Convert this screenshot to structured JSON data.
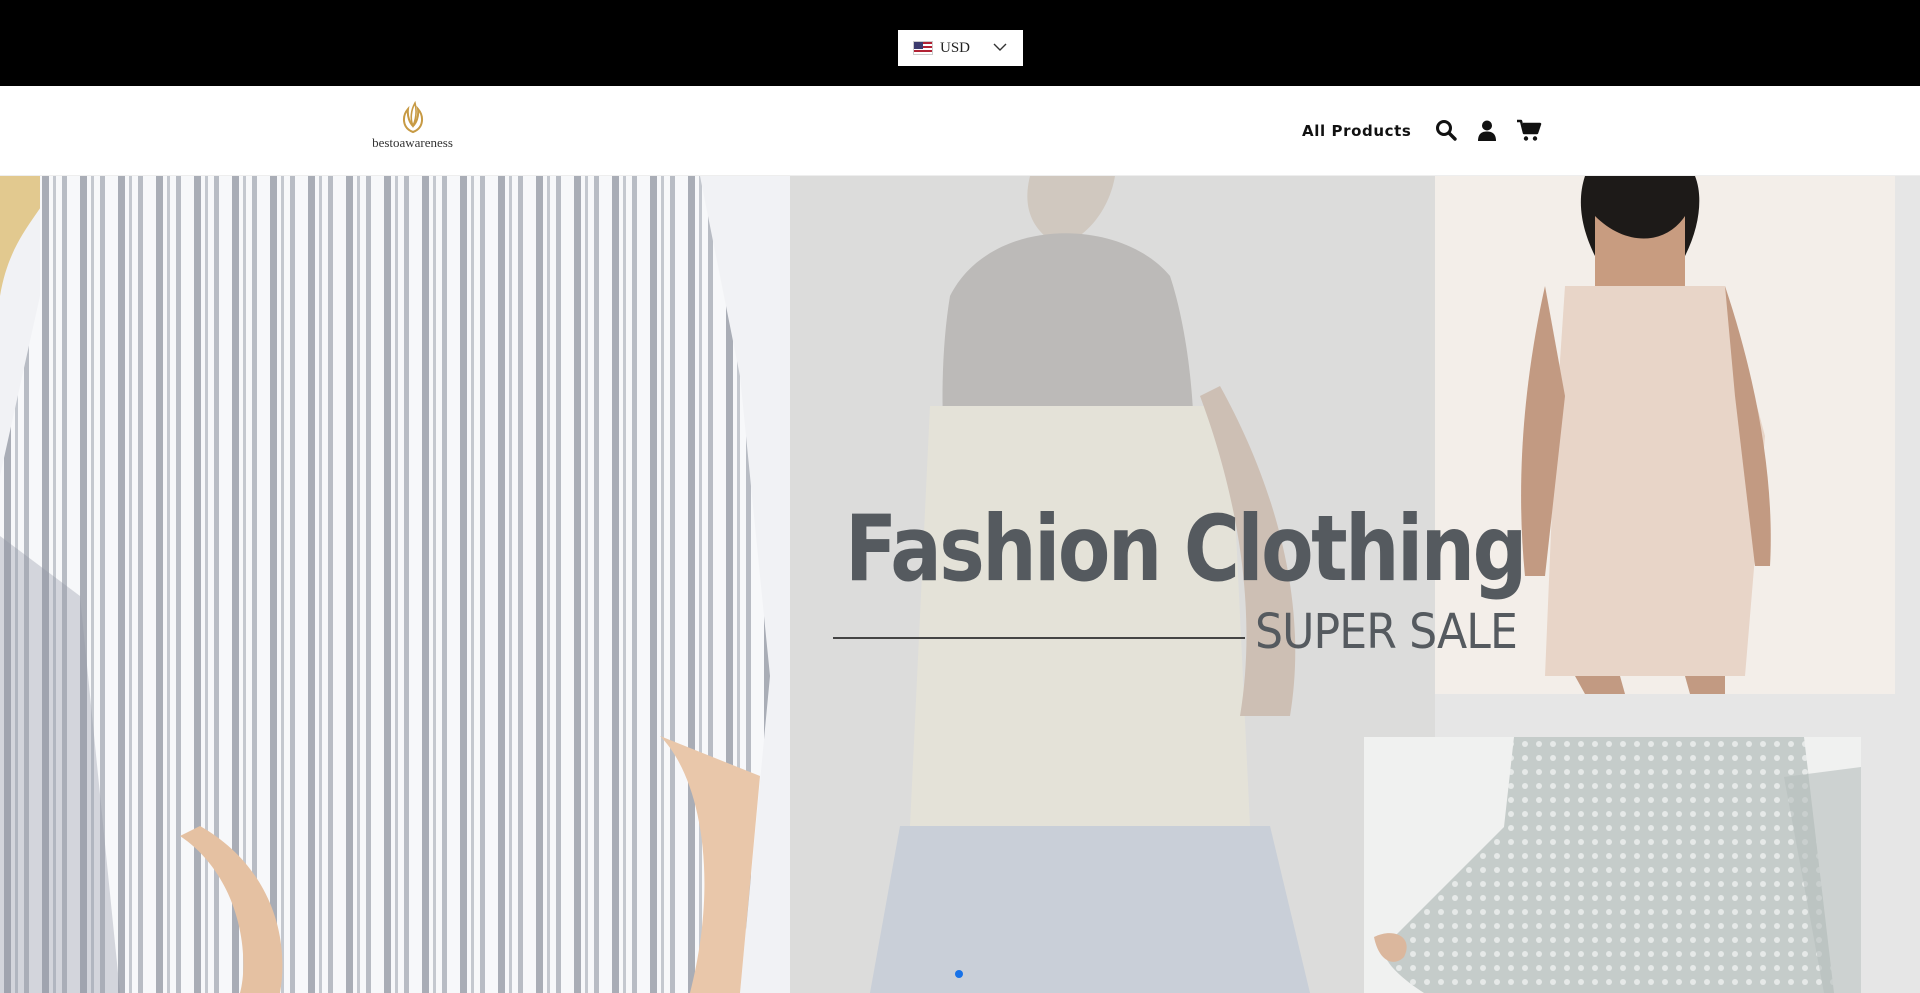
{
  "topbar": {
    "currency": {
      "label": "USD",
      "flag_icon": "us-flag-icon",
      "chevron_icon": "chevron-down-icon"
    }
  },
  "header": {
    "logo_text": "bestoawareness",
    "nav": {
      "all_products": "All Products"
    },
    "icons": [
      "search-icon",
      "account-icon",
      "cart-icon"
    ]
  },
  "hero": {
    "headline": "Fashion Clothing",
    "subheadline": "SUPER SALE",
    "slide_indicator_color": "#1772e8",
    "slides_total": 1,
    "active_slide": 1
  },
  "colors": {
    "topbar_bg": "#000000",
    "headline_text": "#555a5f",
    "logo_accent": "#c79a44"
  }
}
